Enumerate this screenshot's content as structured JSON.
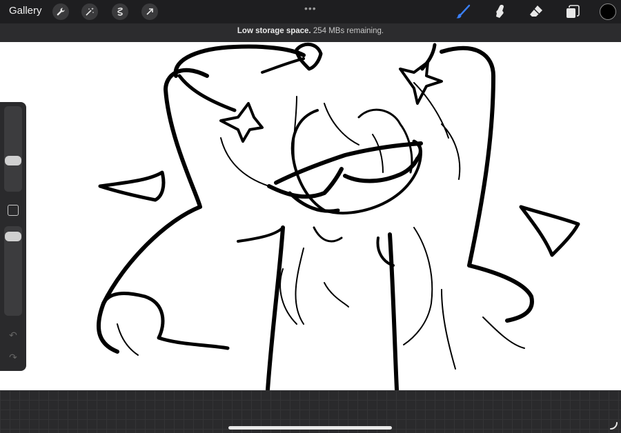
{
  "topbar": {
    "gallery_label": "Gallery",
    "left_tools": [
      "wrench-icon",
      "magic-wand-icon",
      "selection-icon",
      "transform-arrow-icon"
    ],
    "more_dots": "•••",
    "right_tools": [
      "brush-icon",
      "smudge-icon",
      "eraser-icon",
      "layers-icon"
    ],
    "active_tool": "brush",
    "accent_color": "#3a7ff6",
    "current_color": "#000000"
  },
  "notice": {
    "bold": "Low storage space.",
    "text": " 254 MBs remaining."
  },
  "sidebar": {
    "brush_size_level": 0.35,
    "opacity_level": 0.05,
    "undo_glyph": "↶",
    "redo_glyph": "↷"
  }
}
